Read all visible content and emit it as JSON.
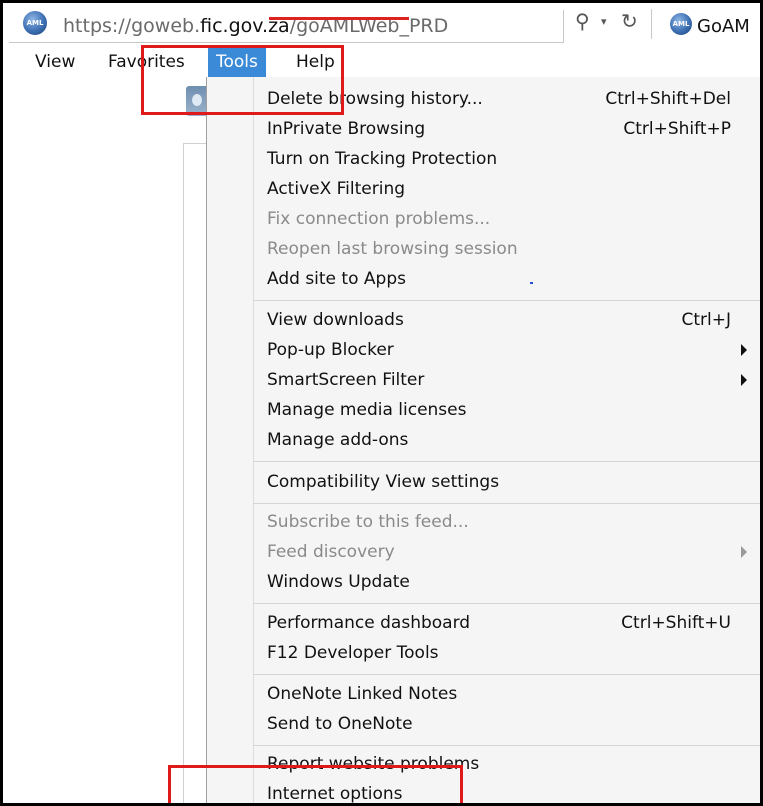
{
  "address_bar": {
    "url_prefix": "https://goweb.",
    "url_host": "fic.gov.za",
    "url_path": "/goAMLWeb_PRD",
    "site_icon_text": "AML",
    "search_glyph": "⚲",
    "dropdown_glyph": "▾",
    "refresh_glyph": "↻",
    "tab_title": "GoAM"
  },
  "menubar": {
    "items": [
      {
        "label": "View"
      },
      {
        "label": "Favorites"
      },
      {
        "label": "Tools"
      },
      {
        "label": "Help"
      }
    ],
    "active": "Tools"
  },
  "tools_menu": {
    "items": [
      {
        "label": "Delete browsing history...",
        "shortcut": "Ctrl+Shift+Del"
      },
      {
        "label": "InPrivate Browsing",
        "shortcut": "Ctrl+Shift+P"
      },
      {
        "label": "Turn on Tracking Protection",
        "shortcut": ""
      },
      {
        "label": "ActiveX Filtering",
        "shortcut": ""
      },
      {
        "label": "Fix connection problems...",
        "shortcut": "",
        "disabled": true
      },
      {
        "label": "Reopen last browsing session",
        "shortcut": "",
        "disabled": true
      },
      {
        "label": "Add site to Apps",
        "shortcut": ""
      },
      {
        "label": "View downloads",
        "shortcut": "Ctrl+J"
      },
      {
        "label": "Pop-up Blocker",
        "shortcut": "",
        "submenu": true
      },
      {
        "label": "SmartScreen Filter",
        "shortcut": "",
        "submenu": true
      },
      {
        "label": "Manage media licenses",
        "shortcut": ""
      },
      {
        "label": "Manage add-ons",
        "shortcut": ""
      },
      {
        "label": "Compatibility View settings",
        "shortcut": ""
      },
      {
        "label": "Subscribe to this feed...",
        "shortcut": "",
        "disabled": true
      },
      {
        "label": "Feed discovery",
        "shortcut": "",
        "disabled": true,
        "submenu": true
      },
      {
        "label": "Windows Update",
        "shortcut": ""
      },
      {
        "label": "Performance dashboard",
        "shortcut": "Ctrl+Shift+U"
      },
      {
        "label": "F12 Developer Tools",
        "shortcut": ""
      },
      {
        "label": "OneNote Linked Notes",
        "shortcut": ""
      },
      {
        "label": "Send to OneNote",
        "shortcut": ""
      },
      {
        "label": "Report website problems",
        "shortcut": ""
      },
      {
        "label": "Internet options",
        "shortcut": ""
      }
    ]
  },
  "colors": {
    "active_menu": "#3b8ad8",
    "highlight_box": "#e01a1a",
    "disabled_text": "#8a8a8a"
  }
}
